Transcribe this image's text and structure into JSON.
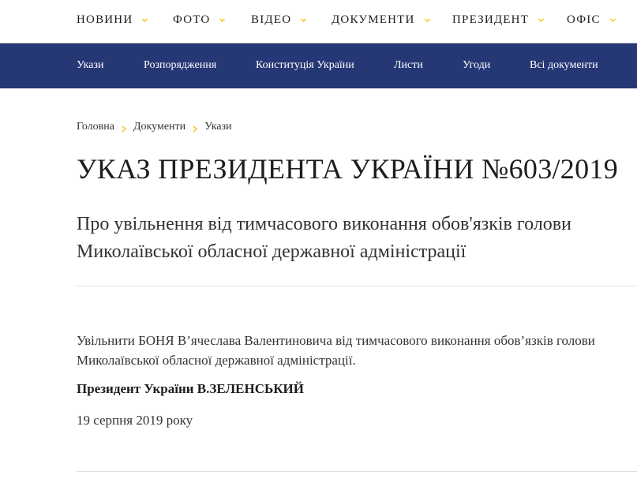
{
  "top_nav": {
    "items": [
      {
        "label": "НОВИНИ"
      },
      {
        "label": "ФОТО"
      },
      {
        "label": "ВІДЕО"
      },
      {
        "label": "ДОКУМЕНТИ"
      },
      {
        "label": "ПРЕЗИДЕНТ"
      },
      {
        "label": "ОФІС"
      }
    ],
    "chevron_color": "#f5c400"
  },
  "sub_nav": {
    "background": "#263775",
    "items": [
      {
        "label": "Укази"
      },
      {
        "label": "Розпорядження"
      },
      {
        "label": "Конституція України"
      },
      {
        "label": "Листи"
      },
      {
        "label": "Угоди"
      },
      {
        "label": "Всі документи"
      }
    ]
  },
  "breadcrumb": {
    "items": [
      "Головна",
      "Документи",
      "Укази"
    ]
  },
  "document": {
    "title": "УКАЗ ПРЕЗИДЕНТА УКРАЇНИ №603/2019",
    "subtitle": "Про увільнення від тимчасового виконання обов'язків голови Миколаївської обласної державної адміністрації",
    "body": "Увільнити БОНЯ В’ячеслава Валентиновича від тимчасового виконання обов’язків голови Миколаївської обласної державної адміністрації.",
    "signature": "Президент України В.ЗЕЛЕНСЬКИЙ",
    "date": "19 серпня 2019 року"
  }
}
